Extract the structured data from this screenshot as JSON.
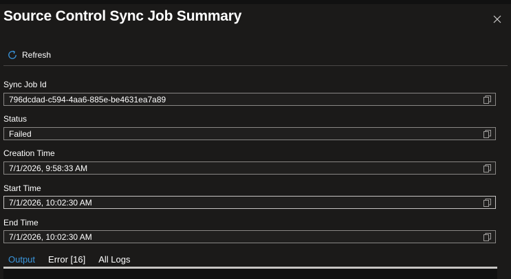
{
  "panel": {
    "title": "Source Control Sync Job Summary"
  },
  "toolbar": {
    "refresh_label": "Refresh"
  },
  "fields": [
    {
      "label": "Sync Job Id",
      "value": "796dcdad-c594-4aa6-885e-be4631ea7a89"
    },
    {
      "label": "Status",
      "value": "Failed"
    },
    {
      "label": "Creation Time",
      "value": "7/1/2026, 9:58:33 AM"
    },
    {
      "label": "Start Time",
      "value": "7/1/2026, 10:02:30 AM"
    },
    {
      "label": "End Time",
      "value": "7/1/2026, 10:02:30 AM"
    }
  ],
  "tabs": [
    {
      "label": "Output",
      "selected": true
    },
    {
      "label": "Error [16]",
      "selected": false
    },
    {
      "label": "All Logs",
      "selected": false
    }
  ],
  "colors": {
    "accent": "#3a96dd",
    "background": "#1b1a19",
    "field_border": "#8a8886"
  },
  "icons": {
    "close": "close-icon",
    "refresh": "refresh-icon",
    "copy": "copy-icon"
  }
}
